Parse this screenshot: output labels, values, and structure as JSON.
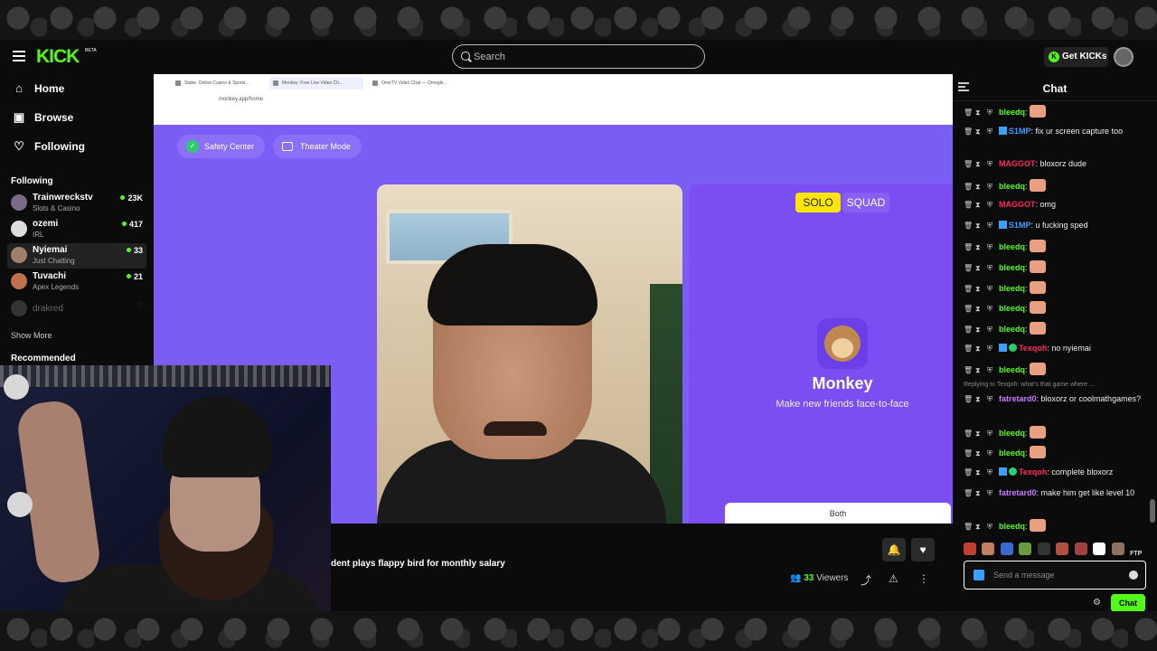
{
  "topbar": {
    "logo": "KICK",
    "logo_sup": "BETA",
    "search_placeholder": "Search",
    "get_kicks": "Get KICKs",
    "get_kicks_icon": "K"
  },
  "sidebar": {
    "nav": [
      {
        "label": "Home",
        "icon": "home-icon"
      },
      {
        "label": "Browse",
        "icon": "browse-icon"
      },
      {
        "label": "Following",
        "icon": "heart-icon"
      }
    ],
    "following_title": "Following",
    "channels": [
      {
        "name": "Trainwreckstv",
        "category": "Slots & Casino",
        "viewers": "23K"
      },
      {
        "name": "ozemi",
        "category": "IRL",
        "viewers": "417"
      },
      {
        "name": "Nyiemai",
        "category": "Just Chatting",
        "viewers": "33"
      },
      {
        "name": "Tuvachi",
        "category": "Apex Legends",
        "viewers": "21"
      },
      {
        "name": "drakred",
        "category": "",
        "viewers": ""
      }
    ],
    "show_more": "Show More",
    "recommended_title": "Recommended"
  },
  "stream": {
    "browser_tabs": [
      "Stake: Online Casino & Sports...",
      "Monkey: Free Live Video Ch...",
      "OmeTV Video Chat — Omegle..."
    ],
    "url": "monkey.app/home",
    "safety_center": "Safety Center",
    "theater_mode": "Theater Mode",
    "solo": "SOLO",
    "squad": "SQUAD",
    "monkey_title": "Monkey",
    "monkey_subtitle": "Make new friends face-to-face",
    "both": "Both"
  },
  "under": {
    "stream_title": "dent plays flappy bird for monthly salary",
    "viewers_count": "33",
    "viewers_label": "Viewers"
  },
  "chat": {
    "title": "Chat",
    "messages": [
      {
        "user": "bleedq",
        "color": "#53fc18",
        "text": "",
        "emote": true
      },
      {
        "user": "S1MP",
        "color": "#3aa0ff",
        "text": "fix ur screen capture too",
        "emote": false
      },
      {
        "user": "MAGGOT",
        "color": "#ff2a5a",
        "text": "bloxorz dude",
        "emote": false
      },
      {
        "user": "bleedq",
        "color": "#53fc18",
        "text": "",
        "emote": true
      },
      {
        "user": "MAGGOT",
        "color": "#ff2a5a",
        "text": "omg",
        "emote": false
      },
      {
        "user": "S1MP",
        "color": "#3aa0ff",
        "text": "u fucking sped",
        "emote": false
      },
      {
        "user": "bleedq",
        "color": "#53fc18",
        "text": "",
        "emote": true
      },
      {
        "user": "bleedq",
        "color": "#53fc18",
        "text": "",
        "emote": true
      },
      {
        "user": "bleedq",
        "color": "#53fc18",
        "text": "",
        "emote": true
      },
      {
        "user": "bleedq",
        "color": "#53fc18",
        "text": "",
        "emote": true
      },
      {
        "user": "bleedq",
        "color": "#53fc18",
        "text": "",
        "emote": true
      },
      {
        "user": "Texqoh",
        "color": "#ff2a5a",
        "text": "no nyiemai",
        "emote": false
      },
      {
        "user": "bleedq",
        "color": "#53fc18",
        "text": "",
        "emote": true
      },
      {
        "user": "fatretard0",
        "color": "#c77dff",
        "text": "bloxorz or coolmathgames?",
        "emote": false
      },
      {
        "user": "bleedq",
        "color": "#53fc18",
        "text": "",
        "emote": true
      },
      {
        "user": "bleedq",
        "color": "#53fc18",
        "text": "",
        "emote": true
      },
      {
        "user": "Texqoh",
        "color": "#ff2a5a",
        "text": "complete bloxorz",
        "emote": false
      },
      {
        "user": "fatretard0",
        "color": "#c77dff",
        "text": "make him get like level 10",
        "emote": false
      },
      {
        "user": "bleedq",
        "color": "#53fc18",
        "text": "",
        "emote": true
      }
    ],
    "reply_text": "Replying to Texqoh: what's that game where ...",
    "input_placeholder": "Send a message",
    "send_label": "Chat",
    "ftp": "FTP"
  }
}
